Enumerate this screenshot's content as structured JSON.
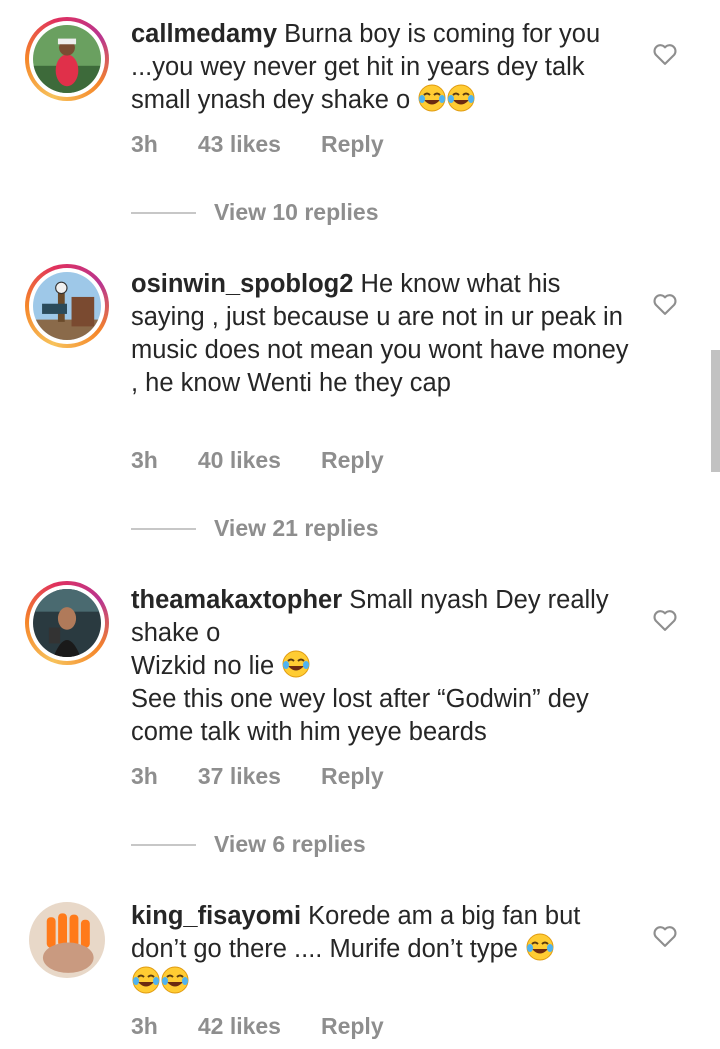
{
  "comments": [
    {
      "username": "callmedamy",
      "text": " Burna boy is coming for you ...you wey never get hit in years dey talk small ynash dey shake o",
      "emoji_count": 2,
      "time": "3h",
      "likes": "43 likes",
      "reply": "Reply",
      "view_replies": "View 10 replies",
      "story_ring": true
    },
    {
      "username": "osinwin_spoblog2",
      "text": " He know what his saying , just because u are not in ur peak in music does not mean you wont have money , he know Wenti he they cap",
      "emoji_count": 0,
      "time": "3h",
      "likes": "40 likes",
      "reply": "Reply",
      "view_replies": "View 21 replies",
      "story_ring": true
    },
    {
      "username": "theamakaxtopher",
      "text": " Small nyash Dey really shake o\nWizkid no lie",
      "text2": " See this one wey lost after “Godwin” dey come talk with him yeye beards",
      "emoji_count": 1,
      "time": "3h",
      "likes": "37 likes",
      "reply": "Reply",
      "view_replies": "View 6 replies",
      "story_ring": true
    },
    {
      "username": "king_fisayomi",
      "text": " Korede am a big fan but don’t go there .... Murife don’t type",
      "emoji_count": 3,
      "time": "3h",
      "likes": "42 likes",
      "reply": "Reply",
      "story_ring": false
    }
  ],
  "icons": {
    "like": "heart-outline-icon",
    "emoji": "face-with-tears-of-joy-emoji"
  },
  "colors": {
    "text": "#262626",
    "secondary": "#8e8e8e",
    "story_ring_start": "#f58529",
    "story_ring_end": "#b9358f"
  }
}
